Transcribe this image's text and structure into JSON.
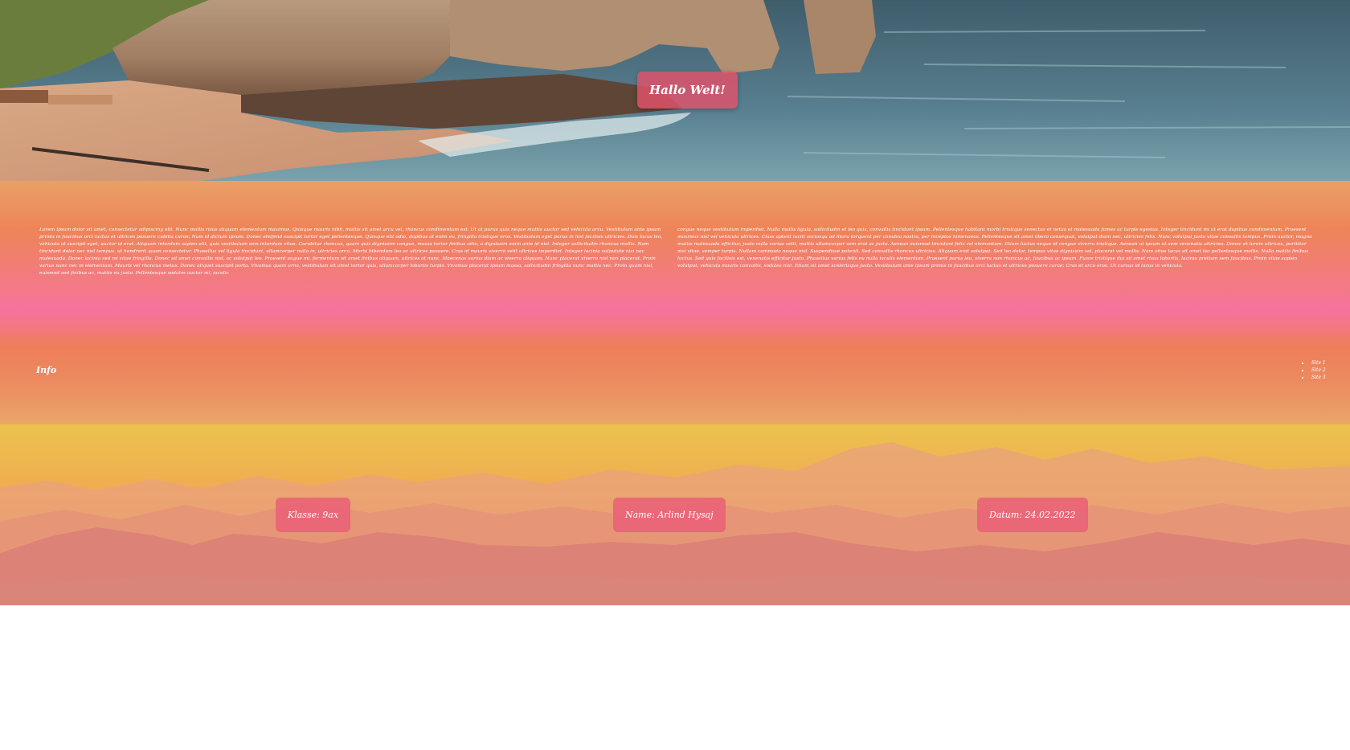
{
  "hero": {
    "title": "Hallo Welt!"
  },
  "content": {
    "paragraph_left": "Lorem ipsum dolor sit amet, consectetur adipiscing elit. Nunc mollis risus aliquam elementum maximus. Quisque mauris nibh, mattis sit amet arcu vel, rhoncus condimentum est. Ut at purus quis neque mattis auctor sed vehicula arcu. Vestibulum ante ipsum primis in faucibus orci luctus et ultrices posuere cubilia curae; Nam id dictum ipsum. Donec eleifend suscipit tortor eget pellentesque. Quisque elit odio, dapibus at enim eu, fringilla tristique eros. Vestibulum eget purus in nisl facilisis ultricies. Duis lacus leo, vehicula at suscipit eget, auctor id erat. Aliquam interdum sapien elit, quis vestibulum sem interdum vitae. Curabitur rhoncus, quam quis dignissim congue, massa tortor finibus odio, a dignissim enim ante id nisl. Integer sollicitudin rhoncus mollis. Nam tincidunt dolor nec nisl tempus, ut hendrerit quam consectetur. Phasellus vel ligula tincidunt, ullamcorper nulla in, ultricies arcu. Morbi bibendum leo ac ultrices posuere. Cras id mauris viverra velit ultrices imperdiet. Integer lacinia vulputate nisi nec malesuada. Donec lacinia sed mi vitae fringilla. Donec sit amet convallis nisl, ac volutpat leo. Praesent augue mi, fermentum sit amet finibus aliquam, ultrices at nunc. Maecenas varius diam ac viverra aliquam. Nunc placerat viverra nisl non placerat. Proin varius nunc nec in elementum. Mauris vel rhoncus metus. Donec aliquet suscipit porta. Vivamus quam urna, vestibulum sit amet tortor quis, ullamcorper lobortis turpis. Vivamus placerat ipsum massa, sollicitudin fringilla nunc mattis nec. Proin quam nisl, euismod sed finibus ac, mattis eu justo. Pellentesque sodales auctor mi, iaculis",
    "paragraph_right": "congue neque vestibulum imperdiet. Nulla mollis ligula, sollicitudin et leo quis, convallis tincidunt ipsum. Pellentesque habitant morbi tristique senectus et netus et malesuada fames ac turpis egestas. Integer tincidunt mi ut erat dapibus condimentum. Praesent maximus nisl vel vehicula ultrices. Class aptent taciti sociosqu ad litora torquent per conubia nostra, per inceptos himenaeos. Pellentesque sit amet libero consequat, volutpat diam nec, ultricies felis. Nunc volutpat justo vitae convallis tempus. Proin auctor, magna mattis malesuada efficitur, justo nulla varius velit, mattis ullamcorper sem erat ac justo. Aenean euismod tincidunt felis vel elementum. Etiam luctus neque id congue viverra tristique. Aenean ut ipsum ut sem venenatis ultricies. Donec et lorem ultrices, porttitor nisi vitae, semper turpis. Nullam commodo neque nisl. Suspendisse potenti. Sed convallis rhoncus ultricies. Aliquam erat volutpat. Sed leo dolor, tempus vitae dignissim vel, placerat vel mollis. Nam vitae lacus sit amet leo pellentesque mollis. Nulla mattis finibus luctus. Sed quis facilisis est, venenatis efficitur justo. Phasellus varius felis eu nulla iaculis elementum. Praesent purus leo, viverra non rhoncus ac, faucibus ac ipsum. Fusce tristique dui sit amet risus lobortis, lacinia pretium sem faucibus. Proin vitae sapien volutpat, vehicula mauris convallis, sodales nisi. Etiam sit amet scelerisque justo. Vestibulum ante ipsum primis in faucibus orci luctus et ultrices posuere curae; Cras et arcu eros. Ut cursus id lacus in vehicula.",
    "info_label": "Info",
    "pages": [
      "Site 1",
      "Site 2",
      "Site 3"
    ]
  },
  "footer": {
    "klasse": "Klasse: 9ax",
    "name": "Name: Arlind Hysaj",
    "datum": "Datum: 24.02.2022"
  }
}
